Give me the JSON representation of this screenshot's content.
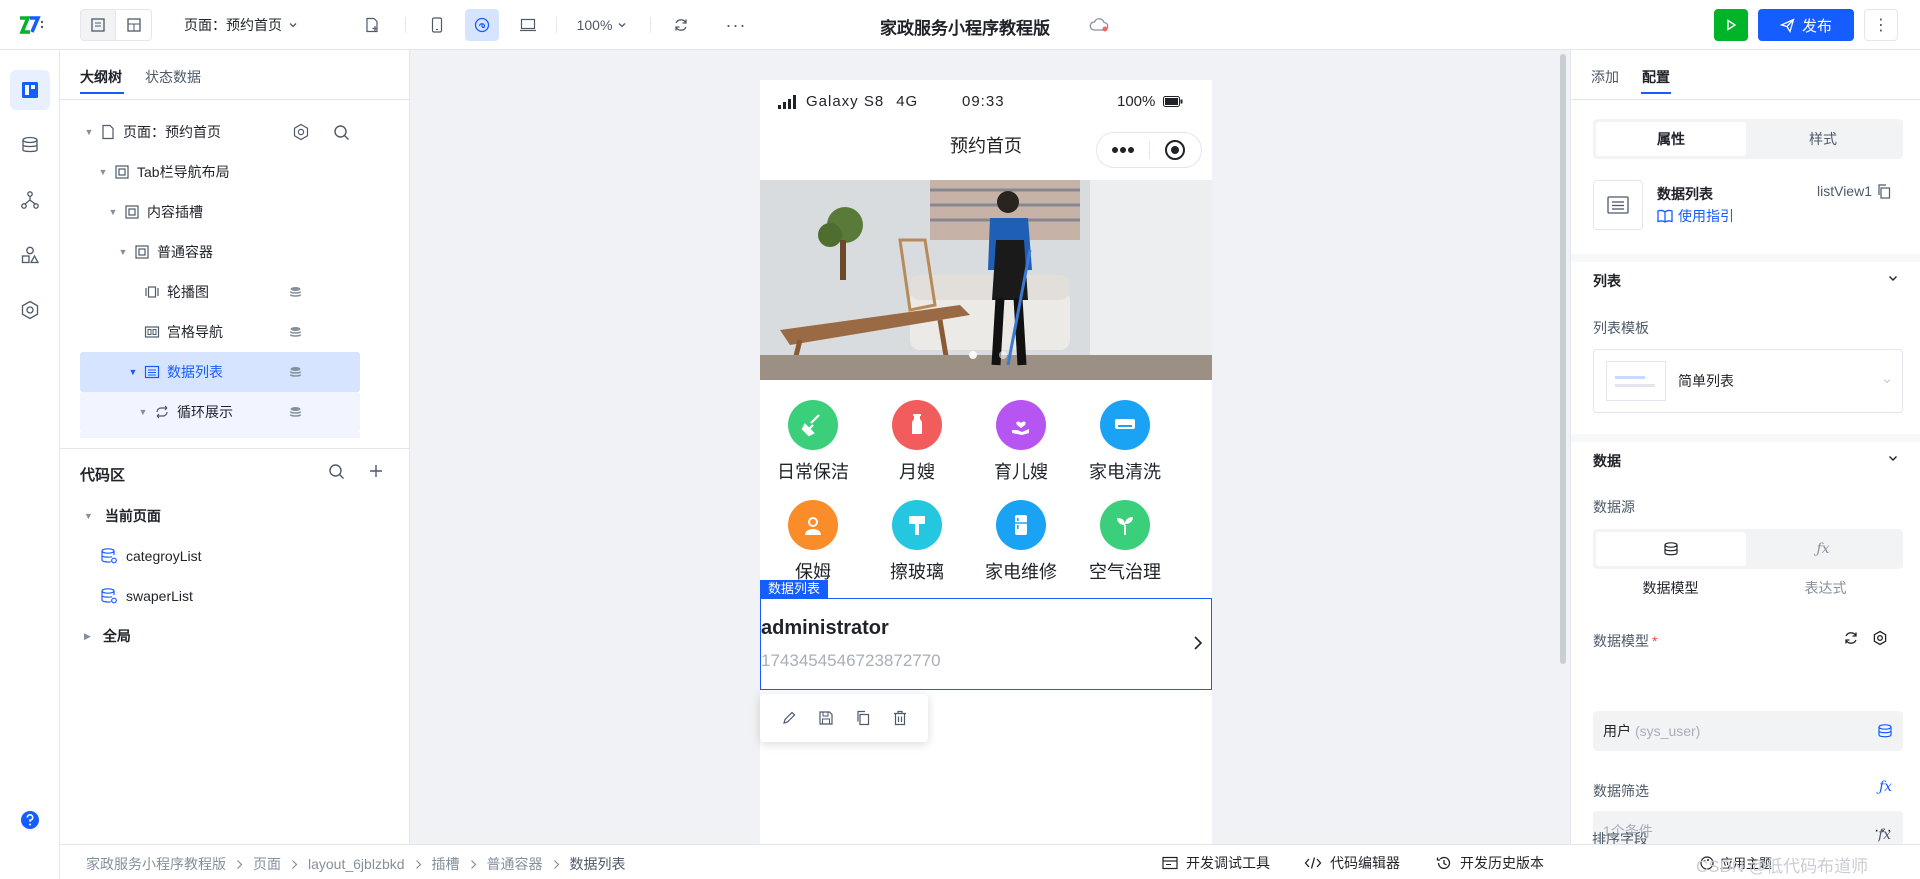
{
  "topbar": {
    "page_selector": "页面：预约首页",
    "zoom": "100%",
    "app_title": "家政服务小程序教程版",
    "publish_label": "发布"
  },
  "colors": {
    "primary": "#165dff",
    "run_green": "#00b42a",
    "selected_row": "#d6e4ff"
  },
  "left": {
    "tabs": [
      "大纲树",
      "状态数据"
    ],
    "tree": [
      {
        "label": "页面：预约首页",
        "icon": "page-icon"
      },
      {
        "label": "Tab栏导航布局",
        "icon": "container-icon"
      },
      {
        "label": "内容插槽",
        "icon": "container-icon"
      },
      {
        "label": "普通容器",
        "icon": "container-icon"
      },
      {
        "label": "轮播图",
        "icon": "carousel-icon"
      },
      {
        "label": "宫格导航",
        "icon": "grid-icon"
      },
      {
        "label": "数据列表",
        "icon": "list-icon"
      },
      {
        "label": "循环展示",
        "icon": "loop-icon"
      }
    ],
    "code_area": {
      "title": "代码区",
      "current_page": "当前页面",
      "items": [
        "categroyList",
        "swaperList"
      ],
      "global": "全局"
    }
  },
  "phone": {
    "device": "Galaxy S8",
    "network": "4G",
    "time": "09:33",
    "battery": "100%",
    "nav_title": "预约首页",
    "grid": [
      {
        "label": "日常保洁",
        "color": "#3ccf7b",
        "icon": "broom-icon"
      },
      {
        "label": "月嫂",
        "color": "#f25c5c",
        "icon": "bottle-icon"
      },
      {
        "label": "育儿嫂",
        "color": "#b755f2",
        "icon": "hand-heart-icon"
      },
      {
        "label": "家电清洗",
        "color": "#1aa3f5",
        "icon": "aircon-icon"
      },
      {
        "label": "保姆",
        "color": "#fa8c2a",
        "icon": "nanny-icon"
      },
      {
        "label": "擦玻璃",
        "color": "#25c7e0",
        "icon": "wiper-icon"
      },
      {
        "label": "家电维修",
        "color": "#1aa3f5",
        "icon": "fridge-icon"
      },
      {
        "label": "空气治理",
        "color": "#3ccf7b",
        "icon": "sprout-icon"
      }
    ],
    "list_tag": "数据列表",
    "list_item": {
      "title": "administrator",
      "subtitle": "1743454546723872770"
    }
  },
  "right": {
    "tabs": [
      "添加",
      "配置"
    ],
    "seg": [
      "属性",
      "样式"
    ],
    "component_name": "数据列表",
    "usage_link": "使用指引",
    "component_id": "listView1",
    "section_list": "列表",
    "template_label": "列表模板",
    "template_value": "简单列表",
    "section_data": "数据",
    "datasource_label": "数据源",
    "ds_options": [
      "数据模型",
      "表达式"
    ],
    "model_label": "数据模型",
    "model_value": "用户",
    "model_sub": "(sys_user)",
    "filter_label": "数据筛选",
    "filter_value": "1个条件",
    "sort_label": "排序字段"
  },
  "bottom": {
    "breadcrumb": [
      "家政服务小程序教程版",
      "页面",
      "layout_6jblzbkd",
      "插槽",
      "普通容器",
      "数据列表"
    ],
    "tools": [
      "开发调试工具",
      "代码编辑器",
      "开发历史版本"
    ],
    "overlay": "应用主题",
    "watermark": "CSDN @低代码布道师"
  }
}
